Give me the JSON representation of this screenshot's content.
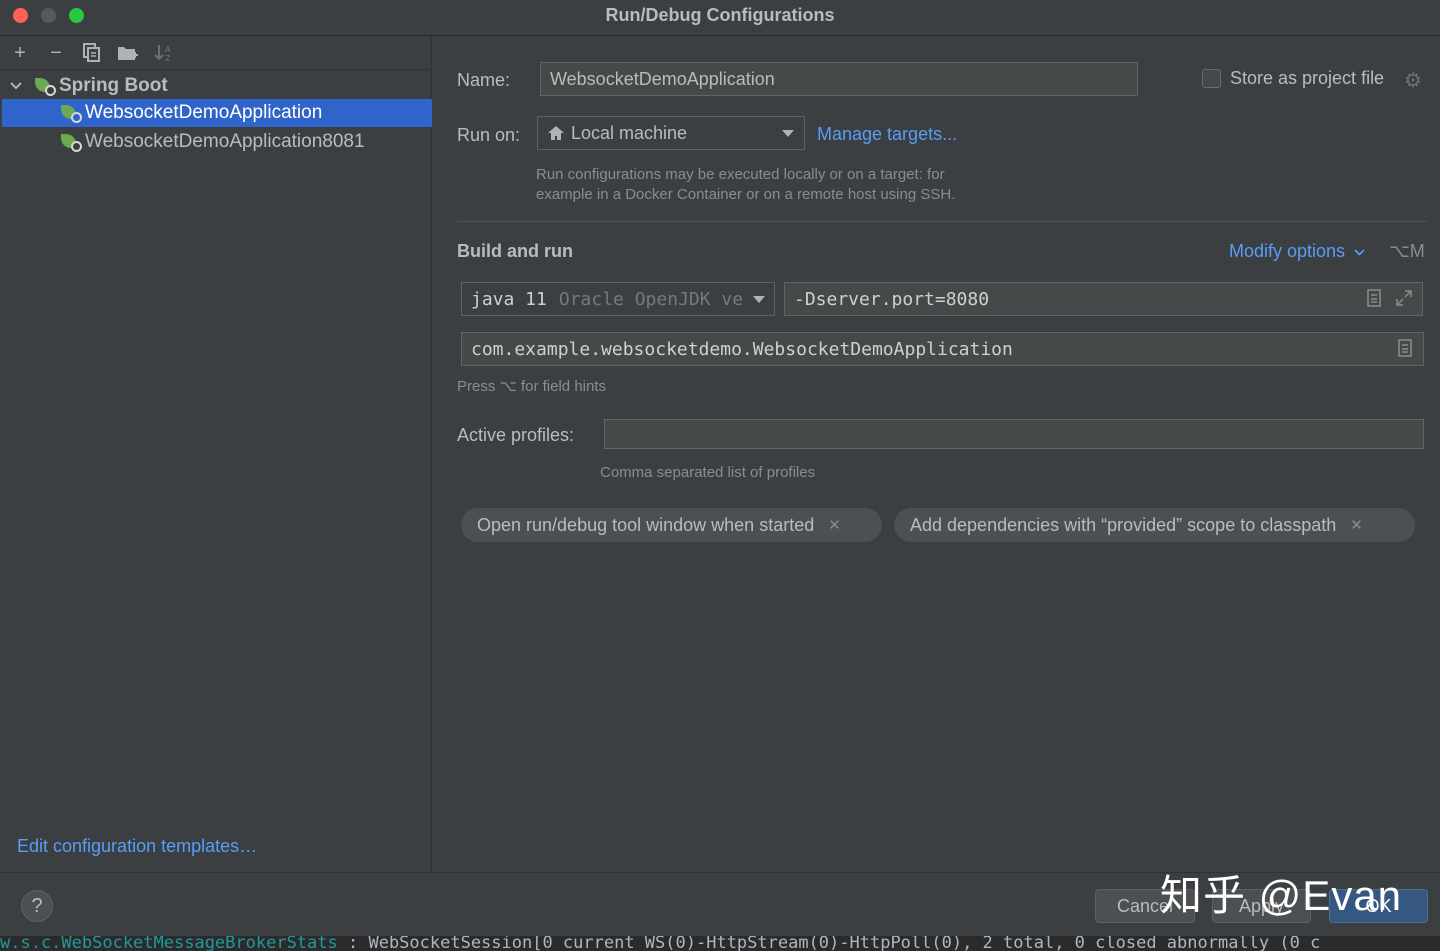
{
  "window": {
    "title": "Run/Debug Configurations"
  },
  "left": {
    "toolbar": {
      "add_icon": "+",
      "remove_icon": "−",
      "copy_icon": "copy-icon",
      "folder_icon": "folder-icon",
      "sort_icon": "sort-icon"
    },
    "tree": {
      "group_label": "Spring Boot",
      "items": [
        {
          "label": "WebsocketDemoApplication",
          "selected": true
        },
        {
          "label": "WebsocketDemoApplication8081",
          "selected": false
        }
      ]
    },
    "edit_templates_link": "Edit configuration templates…"
  },
  "main": {
    "name_label": "Name:",
    "name_value": "WebsocketDemoApplication",
    "store_label": "Store as project file",
    "store_checked": false,
    "run_on_label": "Run on:",
    "run_on_value": "Local machine",
    "manage_targets": "Manage targets...",
    "run_on_hint_line1": "Run configurations may be executed locally or on a target: for",
    "run_on_hint_line2": "example in a Docker Container or on a remote host using SSH.",
    "build_title": "Build and run",
    "modify_options": "Modify options",
    "modify_shortcut": "⌥M",
    "jdk_main": "java 11",
    "jdk_detail": "Oracle OpenJDK ve",
    "vm_options": "-Dserver.port=8080",
    "main_class": "com.example.websocketdemo.WebsocketDemoApplication",
    "field_hint": "Press ⌥ for field hints",
    "profiles_label": "Active profiles:",
    "profiles_value": "",
    "profiles_hint": "Comma separated list of profiles",
    "chips": [
      "Open run/debug tool window when started",
      "Add dependencies with “provided” scope to classpath"
    ]
  },
  "footer": {
    "help": "?",
    "cancel": "Cancel",
    "apply": "Apply",
    "ok": "OK",
    "watermark": "知乎 @Evan"
  },
  "console": {
    "class_text": "w.s.c.WebSocketMessageBrokerStats",
    "message_text": "   : WebSocketSession[0 current WS(0)-HttpStream(0)-HttpPoll(0), 2 total, 0 closed abnormally (0 c"
  },
  "colors": {
    "background": "#3c3f41",
    "selection": "#2f65ca",
    "link": "#589df6",
    "close": "#ff5f57",
    "maximize": "#28c840",
    "primary_button": "#365880"
  }
}
